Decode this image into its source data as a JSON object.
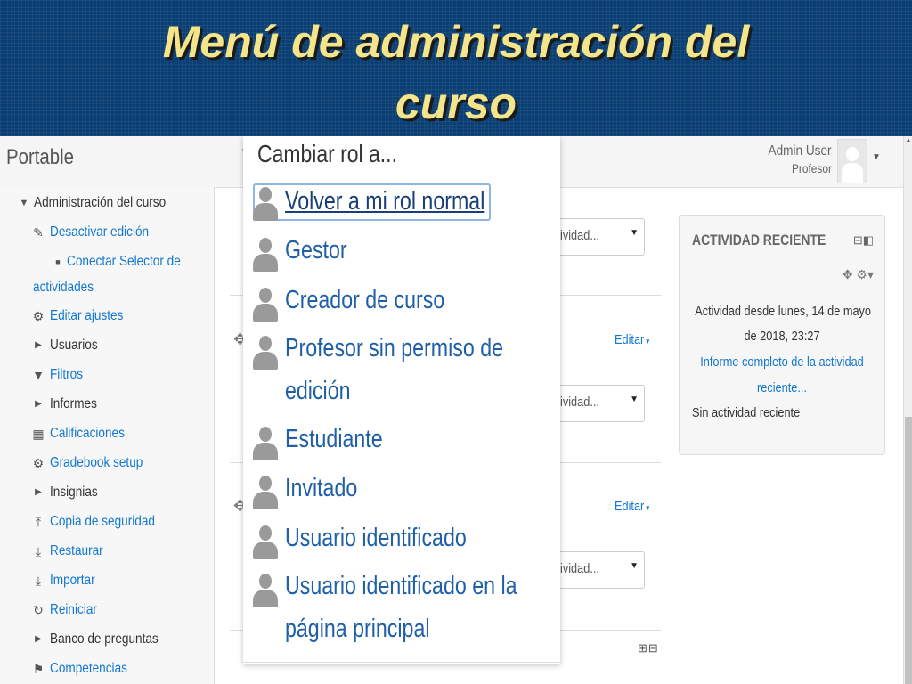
{
  "slide": {
    "title_line1": "Menú de administración del",
    "title_line2": "curso"
  },
  "navbar": {
    "brand": "Portable",
    "user_name": "Admin User",
    "user_role": "Profesor"
  },
  "admin_menu": {
    "items": [
      {
        "label": "Administración del curso",
        "icon": "triangle-down-icon"
      },
      {
        "label": "Desactivar edición",
        "icon": "pencil-icon"
      },
      {
        "label": "Conectar Selector de",
        "icon": "bullet-icon"
      },
      {
        "label": "actividades",
        "icon": ""
      },
      {
        "label": "Editar ajustes",
        "icon": "gear-icon"
      },
      {
        "label": "Usuarios",
        "icon": "triangle-right-icon"
      },
      {
        "label": "Filtros",
        "icon": "filter-icon"
      },
      {
        "label": "Informes",
        "icon": "triangle-right-icon"
      },
      {
        "label": "Calificaciones",
        "icon": "table-icon"
      },
      {
        "label": "Gradebook setup",
        "icon": "gear-icon"
      },
      {
        "label": "Insignias",
        "icon": "triangle-right-icon"
      },
      {
        "label": "Copia de seguridad",
        "icon": "upload-icon"
      },
      {
        "label": "Restaurar",
        "icon": "download-icon"
      },
      {
        "label": "Importar",
        "icon": "download-icon"
      },
      {
        "label": "Reiniciar",
        "icon": "refresh-icon"
      },
      {
        "label": "Banco de preguntas",
        "icon": "triangle-right-icon"
      },
      {
        "label": "Competencias",
        "icon": "competency-icon"
      }
    ]
  },
  "main": {
    "selects": [
      "ividad...",
      "ividad...",
      "ividad..."
    ],
    "edit_label": "Editar"
  },
  "recent_activity": {
    "header": "ACTIVIDAD RECIENTE",
    "line1": "Actividad desde lunes, 14 de mayo",
    "line2": "de 2018, 23:27",
    "link1": "Informe completo de la actividad",
    "link2": "reciente...",
    "empty": "Sin actividad reciente"
  },
  "dropdown": {
    "header": "Cambiar rol a...",
    "roles": [
      {
        "lines": [
          "Volver a mi rol normal"
        ]
      },
      {
        "lines": [
          "Gestor"
        ]
      },
      {
        "lines": [
          "Creador de curso"
        ]
      },
      {
        "lines": [
          "Profesor sin permiso de",
          "edición"
        ]
      },
      {
        "lines": [
          "Estudiante"
        ]
      },
      {
        "lines": [
          "Invitado"
        ]
      },
      {
        "lines": [
          "Usuario identificado"
        ]
      },
      {
        "lines": [
          "Usuario identificado en la",
          "página principal"
        ]
      }
    ]
  },
  "colors": {
    "banner_bg": "#0b3f74",
    "title_text": "#f4e48a",
    "link": "#1177d1",
    "role_text": "#1f5fa8"
  }
}
